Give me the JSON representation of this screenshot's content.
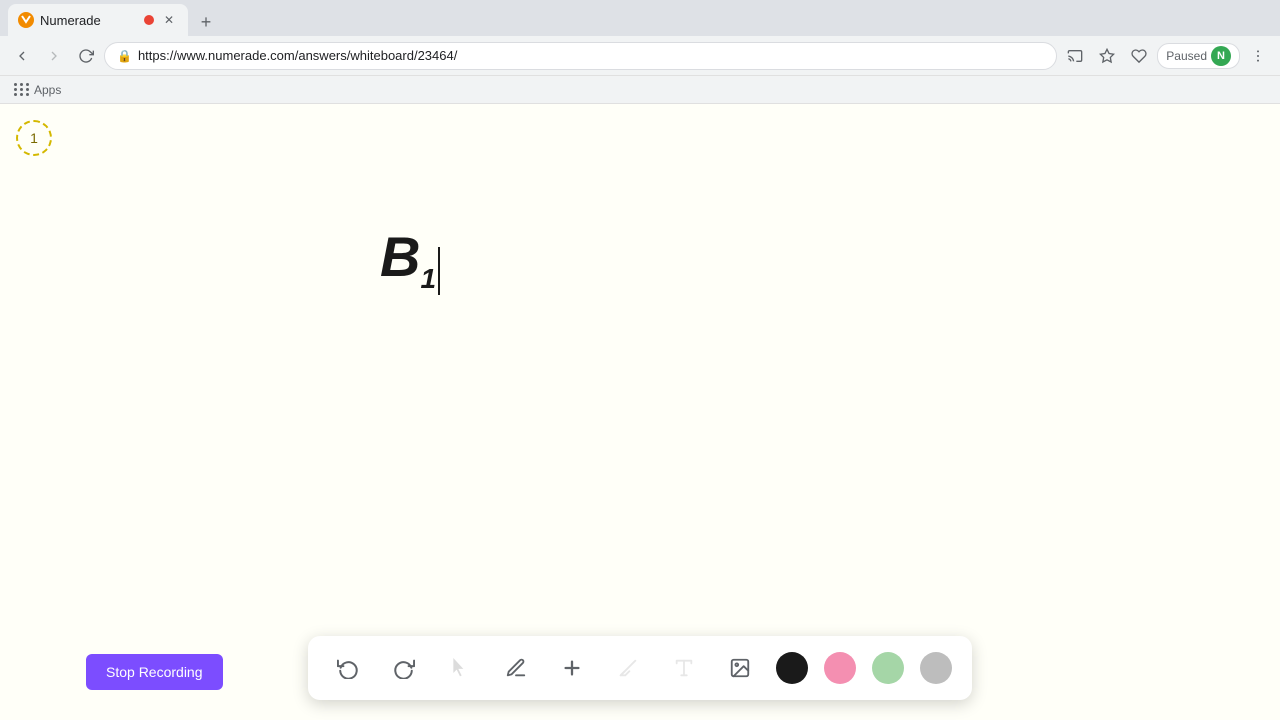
{
  "browser": {
    "tab": {
      "title": "Numerade",
      "favicon_letter": "N",
      "url": "https://www.numerade.com/answers/whiteboard/23464/"
    },
    "bookmarks": {
      "apps_label": "Apps"
    },
    "toolbar_right": {
      "paused_label": "Paused",
      "user_initial": "N"
    }
  },
  "whiteboard": {
    "slide_number": "1",
    "content_text": "B₁"
  },
  "toolbar": {
    "undo_label": "↺",
    "redo_label": "↻",
    "stop_recording_label": "Stop Recording",
    "colors": {
      "black": "#1a1a1a",
      "pink": "#f48fb1",
      "green": "#a5d6a7",
      "gray": "#bdbdbd"
    }
  }
}
